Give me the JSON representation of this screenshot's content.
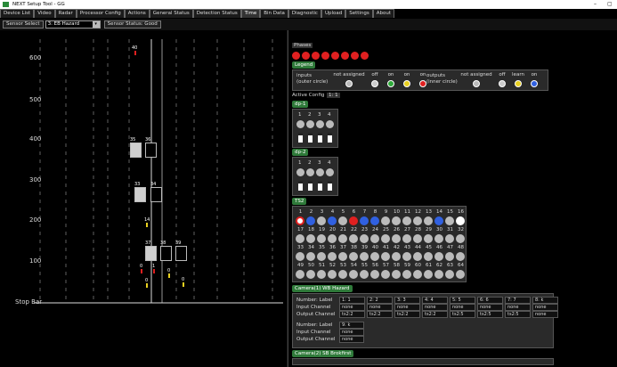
{
  "window": {
    "title": "NEXT Setup Tool - GG",
    "minimize": "–",
    "maximize": "▢"
  },
  "tabs": [
    "Device List",
    "Video",
    "Radar",
    "Processor Config",
    "Actions",
    "General Status",
    "Detection Status",
    "Time",
    "Bin Data",
    "Diagnostic",
    "Upload",
    "Settings",
    "About"
  ],
  "toolbar": {
    "sensor_select_label": "Sensor Select",
    "sensor_value": "3: EB Hazard",
    "sensor_status": "Sensor Status: Good"
  },
  "plot": {
    "y_ticks": [
      "600",
      "500",
      "400",
      "300",
      "200",
      "100"
    ],
    "stop_bar": "Stop Bar",
    "detectors": [
      {
        "label": "35",
        "filled": true
      },
      {
        "label": "36",
        "filled": false
      },
      {
        "label": "33",
        "filled": true
      },
      {
        "label": "34",
        "filled": false
      },
      {
        "label": "37",
        "filled": true
      },
      {
        "label": "38",
        "filled": false
      },
      {
        "label": "39",
        "filled": false
      }
    ],
    "vehicle_labels": [
      "40",
      "14",
      "0",
      "1",
      "0",
      "0",
      "0"
    ]
  },
  "phases": {
    "label": "Phases",
    "count": 8,
    "color": "#e02020"
  },
  "legend": {
    "label": "Legend",
    "inputs_label": "inputs\n(outer circle)",
    "outputs_label": "outputs\n(inner circle)",
    "inputs": [
      {
        "label": "not assigned",
        "color": "#bbbbbb"
      },
      {
        "label": "off",
        "color": "#cccccc"
      },
      {
        "label": "on",
        "color": "#2faa3a"
      },
      {
        "label": "on",
        "color": "#e8d020"
      },
      {
        "label": "on",
        "color": "#e02020"
      }
    ],
    "outputs": [
      {
        "label": "not assigned",
        "color": "#bbbbbb"
      },
      {
        "label": "off",
        "color": "#cccccc"
      },
      {
        "label": "learn",
        "color": "#e8d020"
      },
      {
        "label": "on",
        "color": "#3060e0"
      }
    ]
  },
  "active_config": {
    "label": "Active Config",
    "value": "1: 1"
  },
  "dp1": {
    "label": "dp-1",
    "numbers": [
      "1",
      "2",
      "3",
      "4"
    ]
  },
  "dp2": {
    "label": "dp-2",
    "numbers": [
      "1",
      "2",
      "3",
      "4"
    ]
  },
  "ts2": {
    "label": "TS2",
    "rows": [
      [
        "1",
        "2",
        "3",
        "4",
        "5",
        "6",
        "7",
        "8",
        "9",
        "10",
        "11",
        "12",
        "13",
        "14",
        "15",
        "16"
      ],
      [
        "17",
        "18",
        "19",
        "20",
        "21",
        "22",
        "23",
        "24",
        "25",
        "26",
        "27",
        "28",
        "29",
        "30",
        "31",
        "32"
      ],
      [
        "33",
        "34",
        "35",
        "36",
        "37",
        "38",
        "39",
        "40",
        "41",
        "42",
        "43",
        "44",
        "45",
        "46",
        "47",
        "48"
      ],
      [
        "49",
        "50",
        "51",
        "52",
        "53",
        "54",
        "55",
        "56",
        "57",
        "58",
        "59",
        "60",
        "61",
        "62",
        "63",
        "64"
      ]
    ]
  },
  "camera1": {
    "label": "Camera(1) WB Hazard",
    "row_labels": [
      "Number: Label",
      "Input Channel",
      "Output Channel"
    ],
    "columns": [
      {
        "number": "1: 1",
        "input": "none",
        "output": "ts2:2"
      },
      {
        "number": "2: 2",
        "input": "none",
        "output": "ts2:2"
      },
      {
        "number": "3: 3",
        "input": "none",
        "output": "ts2:2"
      },
      {
        "number": "4: 4",
        "input": "none",
        "output": "ts2:2"
      },
      {
        "number": "5: 5",
        "input": "none",
        "output": "ts2:5"
      },
      {
        "number": "6: 6",
        "input": "none",
        "output": "ts2:5"
      },
      {
        "number": "7: 7",
        "input": "none",
        "output": "ts2:5"
      },
      {
        "number": "8: k",
        "input": "none",
        "output": "none"
      }
    ],
    "extra": {
      "number": "9: k",
      "input": "none",
      "output": "none"
    }
  },
  "camera2": {
    "label": "Camera(2) SB Brokfirst"
  }
}
